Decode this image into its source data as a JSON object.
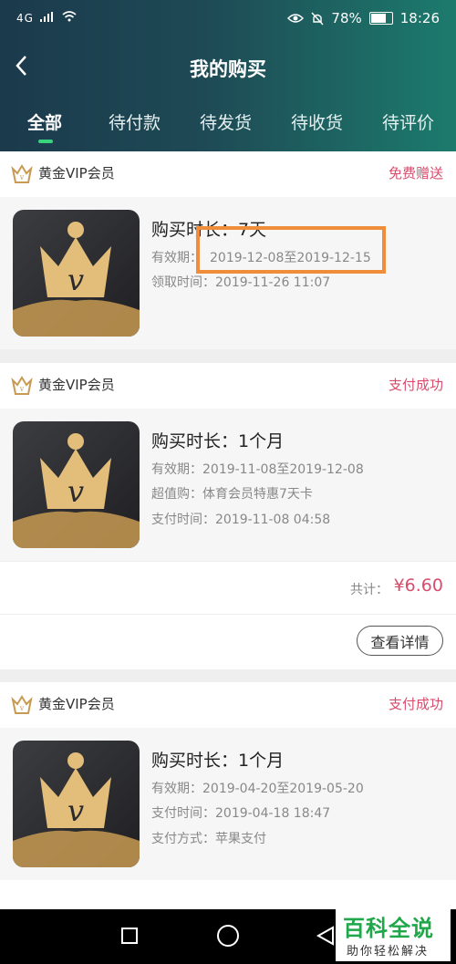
{
  "statusbar": {
    "signal": "4G",
    "battery": "78%",
    "time": "18:26"
  },
  "header": {
    "title": "我的购买"
  },
  "tabs": [
    {
      "label": "全部",
      "active": true
    },
    {
      "label": "待付款"
    },
    {
      "label": "待发货"
    },
    {
      "label": "待收货"
    },
    {
      "label": "待评价"
    }
  ],
  "orders": [
    {
      "product": "黄金VIP会员",
      "status": "免费赠送",
      "duration": "购买时长：7天",
      "validity_label": "有效期：",
      "validity_range": "2019-12-08至2019-12-15",
      "line3": "领取时间：2019-11-26 11:07"
    },
    {
      "product": "黄金VIP会员",
      "status": "支付成功",
      "duration": "购买时长：1个月",
      "validity": "有效期：2019-11-08至2019-12-08",
      "line3": "超值购：体育会员特惠7天卡",
      "line4": "支付时间：2019-11-08 04:58",
      "total_label": "共计：",
      "total": "¥6.60",
      "detail_btn": "查看详情"
    },
    {
      "product": "黄金VIP会员",
      "status": "支付成功",
      "duration": "购买时长：1个月",
      "validity": "有效期：2019-04-20至2019-05-20",
      "line3": "支付时间：2019-04-18 18:47",
      "line4": "支付方式：苹果支付"
    }
  ],
  "colors": {
    "accent": "#d84d6c",
    "highlight": "#ef8d3b",
    "tab_indicator": "#38d37c"
  },
  "watermark": {
    "title": "百科全说",
    "subtitle": "助你轻松解决"
  }
}
